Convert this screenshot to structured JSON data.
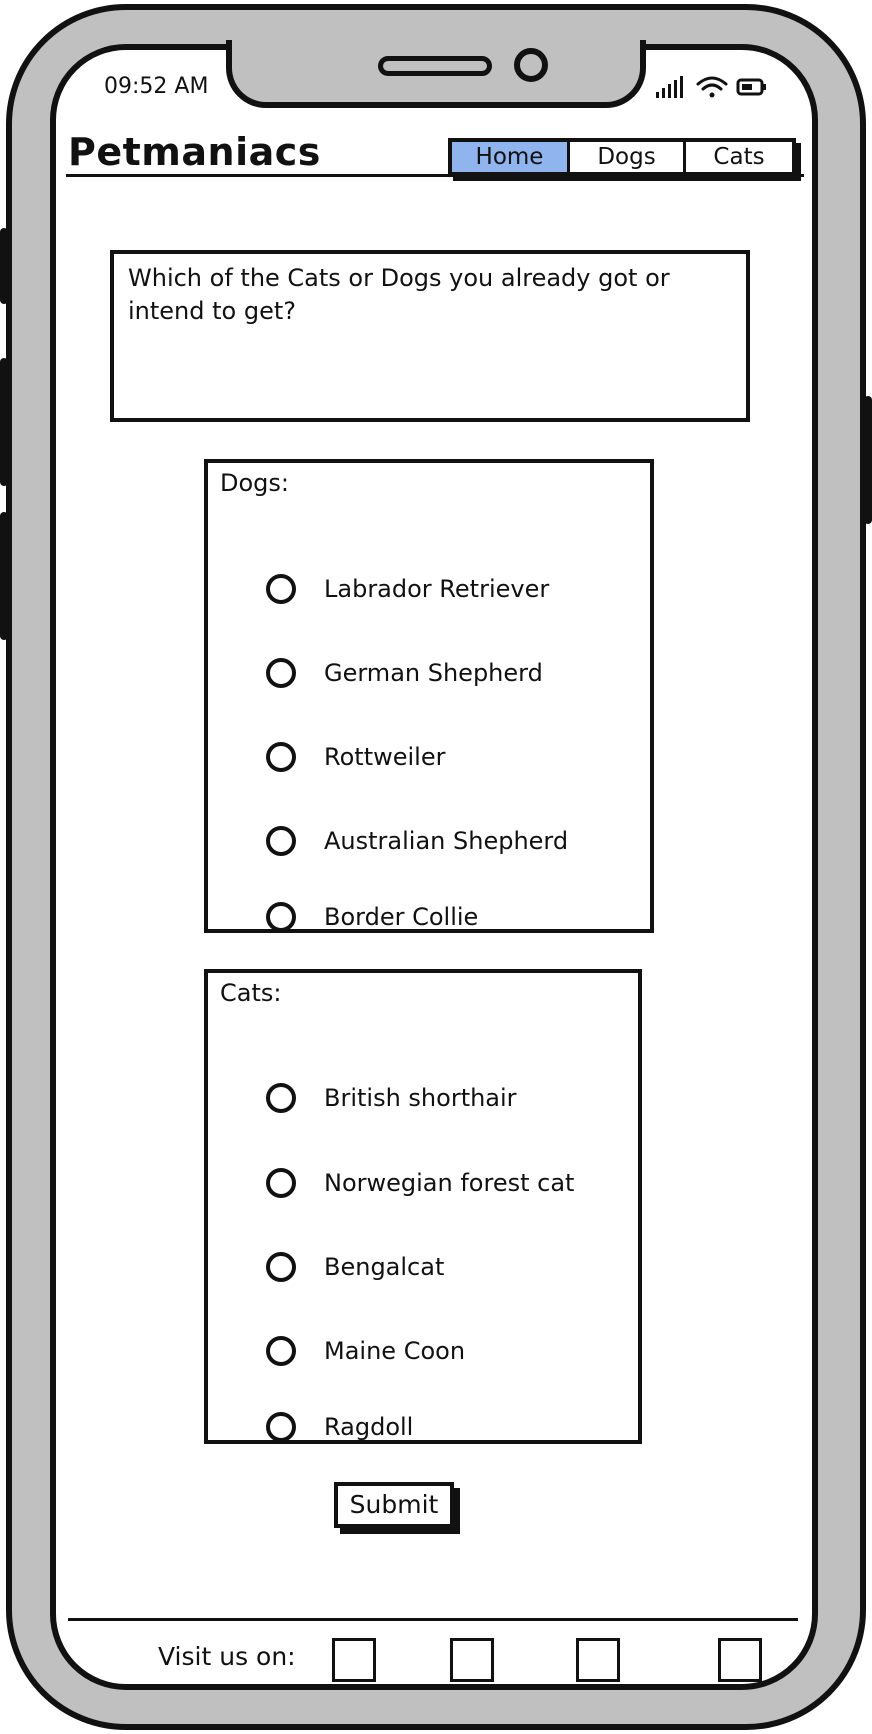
{
  "status_bar": {
    "time": "09:52 AM"
  },
  "header": {
    "brand": "Petmaniacs",
    "nav": [
      {
        "label": "Home",
        "active": true
      },
      {
        "label": "Dogs",
        "active": false
      },
      {
        "label": "Cats",
        "active": false
      }
    ]
  },
  "question": "Which of the Cats or Dogs you already got or intend to get?",
  "dogs": {
    "label": "Dogs:",
    "options": [
      "Labrador Retriever",
      "German Shepherd",
      "Rottweiler",
      "Australian Shepherd",
      "Border Collie"
    ]
  },
  "cats": {
    "label": "Cats:",
    "options": [
      "British shorthair",
      "Norwegian forest cat",
      "Bengalcat",
      "Maine Coon",
      "Ragdoll"
    ]
  },
  "submit_label": "Submit",
  "footer": {
    "visit_label": "Visit us on:"
  },
  "colors": {
    "active_nav": "#8fb4ee",
    "bezel": "#c0c0c0",
    "ink": "#111111"
  }
}
